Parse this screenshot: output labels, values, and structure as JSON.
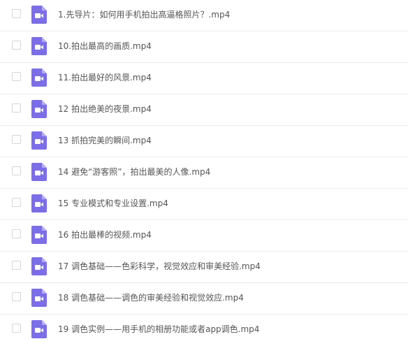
{
  "files": [
    {
      "name": "1.先导片：如何用手机拍出高逼格照片？.mp4",
      "icon": "video-file-icon"
    },
    {
      "name": "10.拍出最高的画质.mp4",
      "icon": "video-file-icon"
    },
    {
      "name": "11.拍出最好的风景.mp4",
      "icon": "video-file-icon"
    },
    {
      "name": "12 拍出绝美的夜景.mp4",
      "icon": "video-file-icon"
    },
    {
      "name": "13 抓拍完美的瞬间.mp4",
      "icon": "video-file-icon"
    },
    {
      "name": "14 避免“游客照”，拍出最美的人像.mp4",
      "icon": "video-file-icon"
    },
    {
      "name": "15 专业模式和专业设置.mp4",
      "icon": "video-file-icon"
    },
    {
      "name": "16 拍出最棒的视频.mp4",
      "icon": "video-file-icon"
    },
    {
      "name": "17 调色基础——色彩科学，视觉效应和审美经验.mp4",
      "icon": "video-file-icon"
    },
    {
      "name": "18 调色基础——调色的审美经验和视觉效应.mp4",
      "icon": "video-file-icon"
    },
    {
      "name": "19 调色实例——用手机的相册功能或者app调色.mp4",
      "icon": "video-file-icon"
    }
  ],
  "colors": {
    "icon_body": "#7b6ee6",
    "icon_fold": "#b4abf3",
    "text": "#555555",
    "divider": "#eeeeee",
    "checkbox_border": "#d5d5d5"
  }
}
